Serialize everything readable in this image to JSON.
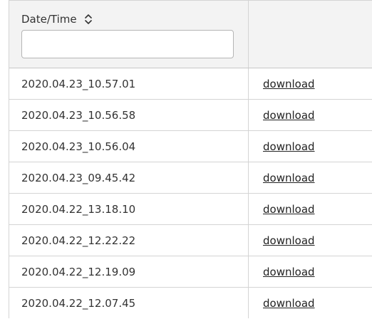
{
  "table": {
    "columns": {
      "date_time": {
        "label": "Date/Time",
        "sort_icon": "sort-up-down-icon"
      },
      "link": {
        "label": ""
      }
    },
    "filter": {
      "value": "",
      "placeholder": ""
    },
    "rows": [
      {
        "date": "2020.04.23_10.57.01",
        "link": "download"
      },
      {
        "date": "2020.04.23_10.56.58",
        "link": "download"
      },
      {
        "date": "2020.04.23_10.56.04",
        "link": "download"
      },
      {
        "date": "2020.04.23_09.45.42",
        "link": "download"
      },
      {
        "date": "2020.04.22_13.18.10",
        "link": "download"
      },
      {
        "date": "2020.04.22_12.22.22",
        "link": "download"
      },
      {
        "date": "2020.04.22_12.19.09",
        "link": "download"
      },
      {
        "date": "2020.04.22_12.07.45",
        "link": "download"
      }
    ]
  },
  "colors": {
    "header_bg": "#f3f3f3",
    "border": "#d4d4d4",
    "text": "#333333"
  }
}
